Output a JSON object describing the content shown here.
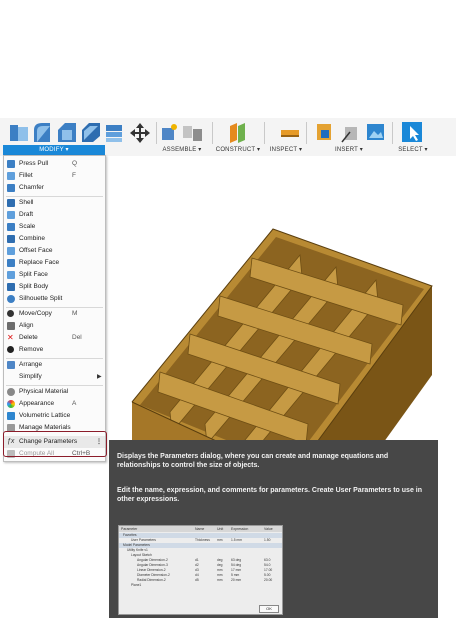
{
  "toolbar": {
    "groups": [
      {
        "label": "MODIFY ▾"
      },
      {
        "label": "ASSEMBLE ▾"
      },
      {
        "label": "CONSTRUCT ▾"
      },
      {
        "label": "INSPECT ▾"
      },
      {
        "label": "INSERT ▾"
      },
      {
        "label": "SELECT ▾"
      }
    ]
  },
  "menu": {
    "items": [
      {
        "label": "Press Pull",
        "shortcut": "Q"
      },
      {
        "label": "Fillet",
        "shortcut": "F"
      },
      {
        "label": "Chamfer",
        "shortcut": ""
      },
      {
        "label": "Shell",
        "shortcut": ""
      },
      {
        "label": "Draft",
        "shortcut": ""
      },
      {
        "label": "Scale",
        "shortcut": ""
      },
      {
        "label": "Combine",
        "shortcut": ""
      },
      {
        "label": "Offset Face",
        "shortcut": ""
      },
      {
        "label": "Replace Face",
        "shortcut": ""
      },
      {
        "label": "Split Face",
        "shortcut": ""
      },
      {
        "label": "Split Body",
        "shortcut": ""
      },
      {
        "label": "Silhouette Split",
        "shortcut": ""
      },
      {
        "label": "Move/Copy",
        "shortcut": "M"
      },
      {
        "label": "Align",
        "shortcut": ""
      },
      {
        "label": "Delete",
        "shortcut": "Del"
      },
      {
        "label": "Remove",
        "shortcut": ""
      },
      {
        "label": "Arrange",
        "shortcut": ""
      },
      {
        "label": "Simplify",
        "shortcut": ""
      },
      {
        "label": "Physical Material",
        "shortcut": ""
      },
      {
        "label": "Appearance",
        "shortcut": "A"
      },
      {
        "label": "Volumetric Lattice",
        "shortcut": ""
      },
      {
        "label": "Manage Materials",
        "shortcut": ""
      },
      {
        "label": "Change Parameters",
        "shortcut": ""
      },
      {
        "label": "Compute All",
        "shortcut": "Ctrl+B"
      }
    ]
  },
  "tooltip": {
    "para1": "Displays the Parameters dialog, where you can create and manage equations and relationships to control the size of objects.",
    "para2": "Edit the name, expression, and comments for parameters. Create User Parameters to use in other expressions.",
    "dialog": {
      "headers": [
        "Parameter",
        "Name",
        "Unit",
        "Expression",
        "Value"
      ],
      "rows": [
        [
          "Favorites",
          "",
          "",
          "",
          ""
        ],
        [
          "User Parameters",
          "Thickness",
          "mm",
          "1.5 mm",
          "1.50"
        ],
        [
          "Model Parameters",
          "",
          "",
          "",
          ""
        ],
        [
          "Utility Knife v1",
          "",
          "",
          "",
          ""
        ],
        [
          "Layout Sketch",
          "",
          "",
          "",
          ""
        ],
        [
          "Angular Dimension-2",
          "d1",
          "deg",
          "63 deg",
          "63.0"
        ],
        [
          "Angular Dimension-3",
          "d2",
          "deg",
          "54 deg",
          "54.0"
        ],
        [
          "Linear Dimension-2",
          "d3",
          "mm",
          "17 mm",
          "17.00"
        ],
        [
          "Diameter Dimension-2",
          "d4",
          "mm",
          "5 mm",
          "5.00"
        ],
        [
          "Radial Dimension-2",
          "d5",
          "mm",
          "20 mm",
          "20.00"
        ],
        [
          "Plane1",
          "",
          "",
          "",
          ""
        ]
      ],
      "ok_label": "OK"
    }
  },
  "colors": {
    "accent": "#1a88d8",
    "box_light": "#c9a04a",
    "box_mid": "#a77c2c",
    "box_dark": "#6e4e14",
    "highlight": "#8b1c2a"
  }
}
